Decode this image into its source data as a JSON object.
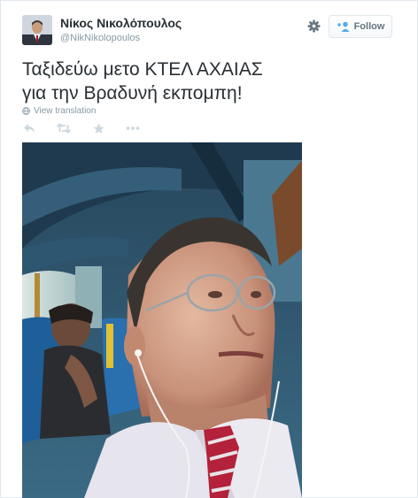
{
  "tweet": {
    "author": {
      "name": "Νίκος Νικολόπουλος",
      "handle": "@NikNikolopoulos",
      "avatar_icon": "user-avatar"
    },
    "follow_label": "Follow",
    "text_lines": [
      "Ταξιδεύω μετο ΚΤΕΛ ΑΧΑΙΑΣ",
      "για την Βραδυνή εκπομπη!"
    ],
    "view_translation_label": "View translation",
    "actions": [
      "reply-icon",
      "retweet-icon",
      "favorite-icon",
      "more-icon"
    ],
    "colors": {
      "link_blue": "#2b7bb9",
      "muted_gray": "#8899a6",
      "action_gray": "#ccd6dd"
    }
  }
}
